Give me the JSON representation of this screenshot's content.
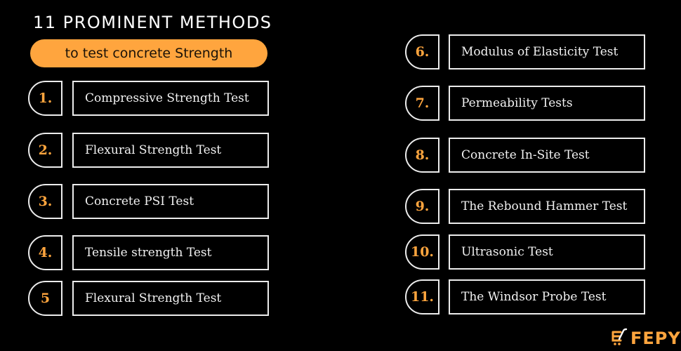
{
  "header": {
    "title": "11 PROMINENT METHODS",
    "subtitle": "to test concrete Strength"
  },
  "colors": {
    "accent": "#FFA53E",
    "background": "#000000",
    "border": "#ECECEC",
    "text": "#F2F2F2"
  },
  "methods": [
    {
      "number": "1.",
      "label": "Compressive Strength Test"
    },
    {
      "number": "2.",
      "label": "Flexural Strength Test"
    },
    {
      "number": "3.",
      "label": "Concrete PSI Test"
    },
    {
      "number": "4.",
      "label": "Tensile strength Test"
    },
    {
      "number": "5",
      "label": "Flexural Strength Test"
    },
    {
      "number": "6.",
      "label": "Modulus of Elasticity Test"
    },
    {
      "number": "7.",
      "label": "Permeability Tests"
    },
    {
      "number": "8.",
      "label": "Concrete In-Site Test"
    },
    {
      "number": "9.",
      "label": "The Rebound Hammer Test"
    },
    {
      "number": "10.",
      "label": "Ultrasonic Test"
    },
    {
      "number": "11.",
      "label": "The Windsor Probe Test"
    }
  ],
  "logo": {
    "icon": "shopping-cart-icon",
    "text": "FEPY"
  }
}
